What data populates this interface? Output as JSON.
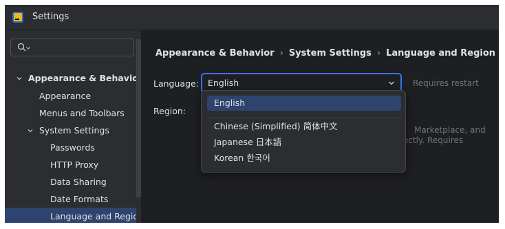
{
  "window": {
    "title": "Settings"
  },
  "search": {
    "placeholder": ""
  },
  "sidebar": {
    "items": [
      {
        "label": "Appearance & Behavior",
        "level": 0,
        "expanded": true
      },
      {
        "label": "Appearance",
        "level": 1
      },
      {
        "label": "Menus and Toolbars",
        "level": 1
      },
      {
        "label": "System Settings",
        "level": 1,
        "expanded": true
      },
      {
        "label": "Passwords",
        "level": 2
      },
      {
        "label": "HTTP Proxy",
        "level": 2
      },
      {
        "label": "Data Sharing",
        "level": 2
      },
      {
        "label": "Date Formats",
        "level": 2
      },
      {
        "label": "Language and Region",
        "level": 2,
        "selected": true
      }
    ]
  },
  "breadcrumb": [
    "Appearance & Behavior",
    "System Settings",
    "Language and Region"
  ],
  "form": {
    "language_label": "Language:",
    "language_value": "English",
    "requires_restart": "Requires restart",
    "region_label": "Region:",
    "region_hint_line1": "Marketplace, and",
    "region_hint_line2": "ectly. Requires"
  },
  "language_options": [
    {
      "label": "English",
      "selected": true
    },
    {
      "label": "Chinese (Simplified) 简体中文"
    },
    {
      "label": "Japanese 日本語"
    },
    {
      "label": "Korean 한국어"
    }
  ],
  "colors": {
    "accent": "#3574f0",
    "selection": "#2e436e",
    "panel_bg": "#2b2d30",
    "content_bg": "#1e1f22"
  }
}
